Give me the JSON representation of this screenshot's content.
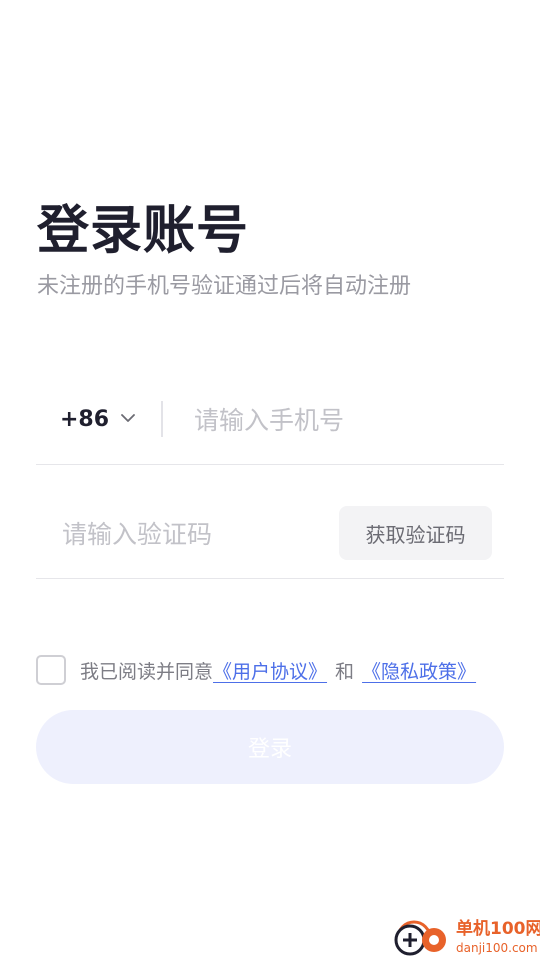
{
  "header": {
    "title": "登录账号",
    "subtitle": "未注册的手机号验证通过后将自动注册"
  },
  "phone": {
    "country_code": "+86",
    "chevron_icon": "chevron-down-icon",
    "placeholder": "请输入手机号",
    "value": ""
  },
  "verification": {
    "placeholder": "请输入验证码",
    "value": "",
    "get_code_label": "获取验证码"
  },
  "agreement": {
    "checked": false,
    "prefix": "我已阅读并同意",
    "user_agreement": "《用户协议》",
    "and": "和",
    "privacy_policy": "《隐私政策》"
  },
  "login": {
    "label": "登录"
  },
  "watermark": {
    "name": "单机100网",
    "domain": "danji100.com"
  },
  "colors": {
    "title": "#1f1f2e",
    "link": "#4d6fe8",
    "login_button_bg": "#eef0fd",
    "watermark": "#e8622a"
  }
}
